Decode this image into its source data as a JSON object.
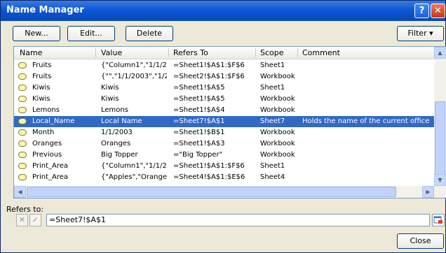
{
  "window": {
    "title": "Name Manager",
    "help_label": "?",
    "close_label": "✕"
  },
  "toolbar": {
    "new_label": "New...",
    "edit_label": "Edit...",
    "delete_label": "Delete",
    "filter_label": "Filter ▾"
  },
  "columns": [
    "Name",
    "Value",
    "Refers To",
    "Scope",
    "Comment"
  ],
  "rows": [
    {
      "name": "Fruits",
      "value": "{\"Column1\",\"1/1/20...",
      "refers_to": "=Sheet1!$A$1:$F$6",
      "scope": "Sheet1",
      "comment": ""
    },
    {
      "name": "Fruits",
      "value": "{\"\",\"1/1/2003\",\"1/2...",
      "refers_to": "=Sheet2!$A$1:$F$6",
      "scope": "Workbook",
      "comment": ""
    },
    {
      "name": "Kiwis",
      "value": "Kiwis",
      "refers_to": "=Sheet1!$A$5",
      "scope": "Sheet1",
      "comment": ""
    },
    {
      "name": "Kiwis",
      "value": "Kiwis",
      "refers_to": "=Sheet1!$A$5",
      "scope": "Workbook",
      "comment": ""
    },
    {
      "name": "Lemons",
      "value": "Lemons",
      "refers_to": "=Sheet1!$A$4",
      "scope": "Workbook",
      "comment": ""
    },
    {
      "name": "Local_Name",
      "value": "Local Name",
      "refers_to": "=Sheet7!$A$1",
      "scope": "Sheet7",
      "comment": "Holds the name of the current office",
      "selected": true
    },
    {
      "name": "Month",
      "value": "1/1/2003",
      "refers_to": "=Sheet1!$B$1",
      "scope": "Workbook",
      "comment": ""
    },
    {
      "name": "Oranges",
      "value": "Oranges",
      "refers_to": "=Sheet1!$A$3",
      "scope": "Workbook",
      "comment": ""
    },
    {
      "name": "Previous",
      "value": "Big Topper",
      "refers_to": "=\"Big Topper\"",
      "scope": "Workbook",
      "comment": ""
    },
    {
      "name": "Print_Area",
      "value": "{\"Column1\",\"1/1/20...",
      "refers_to": "=Sheet1!$A$1:$F$6",
      "scope": "Sheet1",
      "comment": ""
    },
    {
      "name": "Print_Area",
      "value": "{\"Apples\",\"Oranges...",
      "refers_to": "=Sheet4!$A$1:$E$6",
      "scope": "Sheet4",
      "comment": ""
    }
  ],
  "refers_to": {
    "label": "Refers to:",
    "value": "=Sheet7!$A$1",
    "cancel_icon": "✕",
    "enter_icon": "✓"
  },
  "footer": {
    "close_label": "Close"
  }
}
